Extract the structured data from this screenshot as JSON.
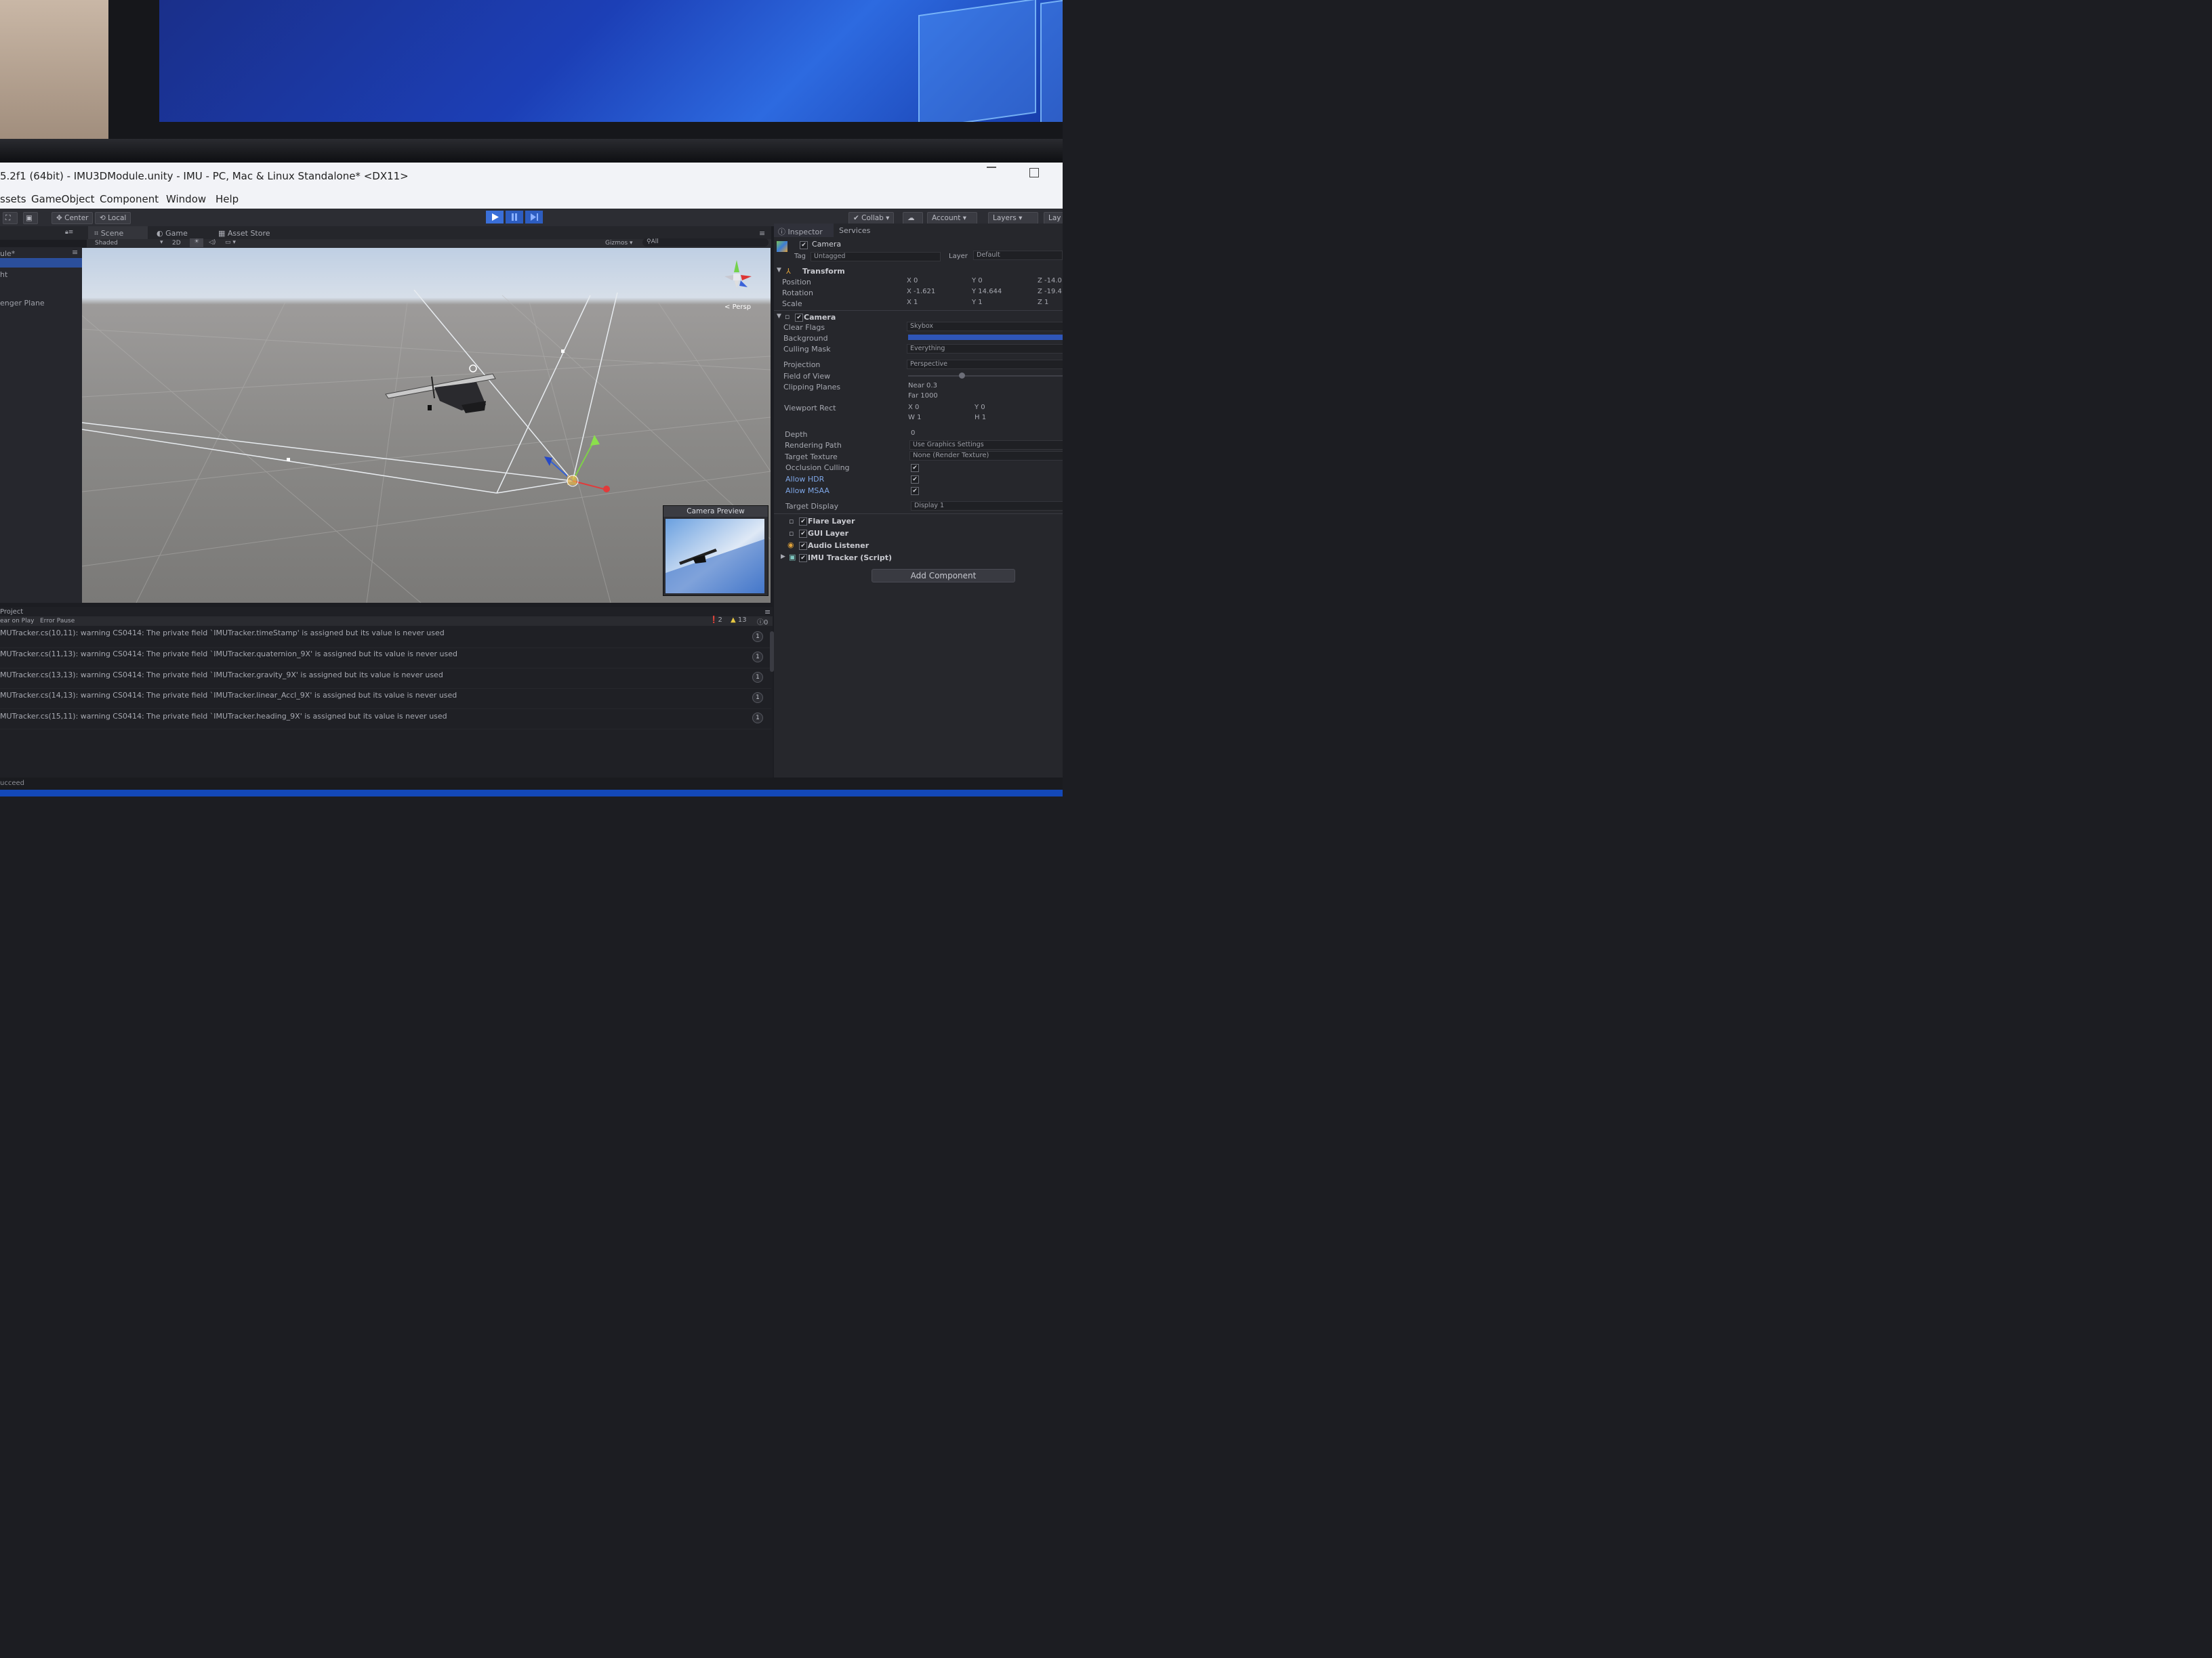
{
  "window": {
    "title": "5.2f1 (64bit) - IMU3DModule.unity - IMU - PC, Mac & Linux Standalone* <DX11>"
  },
  "menu": [
    "ssets",
    "GameObject",
    "Component",
    "Window",
    "Help"
  ],
  "toolbar": {
    "center": "Center",
    "local": "Local",
    "collab": "Collab",
    "account": "Account",
    "layers": "Layers",
    "layout": "Lay"
  },
  "scene_tabs": {
    "scene": "Scene",
    "game": "Game",
    "asset_store": "Asset Store"
  },
  "scene_bar": {
    "shaded": "Shaded",
    "mode_2d": "2D",
    "gizmos": "Gizmos",
    "search": "All"
  },
  "viewport": {
    "persp_label": "Persp"
  },
  "hierarchy": {
    "header": "ule*",
    "items": [
      "ht",
      "enger Plane"
    ]
  },
  "camera_preview": {
    "title": "Camera Preview"
  },
  "inspector": {
    "tab_inspector": "Inspector",
    "tab_services": "Services",
    "object_name": "Camera",
    "tag_label": "Tag",
    "tag_value": "Untagged",
    "layer_label": "Layer",
    "layer_value": "Default",
    "transform": {
      "title": "Transform",
      "rows": [
        {
          "label": "Position",
          "x": "X 0",
          "y": "Y 0",
          "z": "Z -14.0"
        },
        {
          "label": "Rotation",
          "x": "X -1.621",
          "y": "Y 14.644",
          "z": "Z -19.4"
        },
        {
          "label": "Scale",
          "x": "X 1",
          "y": "Y 1",
          "z": "Z 1"
        }
      ]
    },
    "camera": {
      "title": "Camera",
      "clear_flags": "Clear Flags",
      "clear_flags_value": "Skybox",
      "background": "Background",
      "culling_mask": "Culling Mask",
      "culling_mask_value": "Everything",
      "projection": "Projection",
      "projection_value": "Perspective",
      "fov": "Field of View",
      "clipping": "Clipping Planes",
      "near": "Near  0.3",
      "far": "Far   1000",
      "viewport_rect": "Viewport Rect",
      "vx": "X 0",
      "vy": "Y 0",
      "vw": "W 1",
      "vh": "H 1",
      "depth": "Depth",
      "depth_value": "0",
      "rendering_path": "Rendering Path",
      "rendering_path_value": "Use Graphics Settings",
      "target_texture": "Target Texture",
      "target_texture_value": "None (Render Texture)",
      "occlusion": "Occlusion Culling",
      "hdr": "Allow HDR",
      "msaa": "Allow MSAA",
      "target_display": "Target Display",
      "target_display_value": "Display 1"
    },
    "components": [
      "Flare Layer",
      "GUI Layer",
      "Audio Listener",
      "IMU Tracker (Script)"
    ],
    "add_component": "Add Component"
  },
  "console": {
    "tab": "Project",
    "clear_on_play": "ear on Play",
    "error_pause": "Error Pause",
    "count_errors": "2",
    "count_warnings": "13",
    "count_info": "0",
    "messages": [
      {
        "text": "MUTracker.cs(10,11): warning CS0414: The private field `IMUTracker.timeStamp' is assigned but its value is never used",
        "count": "1"
      },
      {
        "text": "MUTracker.cs(11,13): warning CS0414: The private field `IMUTracker.quaternion_9X' is assigned but its value is never used",
        "count": "1"
      },
      {
        "text": "MUTracker.cs(13,13): warning CS0414: The private field `IMUTracker.gravity_9X' is assigned but its value is never used",
        "count": "1"
      },
      {
        "text": "MUTracker.cs(14,13): warning CS0414: The private field `IMUTracker.linear_Accl_9X' is assigned but its value is never used",
        "count": "1"
      },
      {
        "text": "MUTracker.cs(15,11): warning CS0414: The private field `IMUTracker.heading_9X' is assigned but its value is never used",
        "count": "1"
      }
    ]
  },
  "status": {
    "text": "ucceed"
  }
}
